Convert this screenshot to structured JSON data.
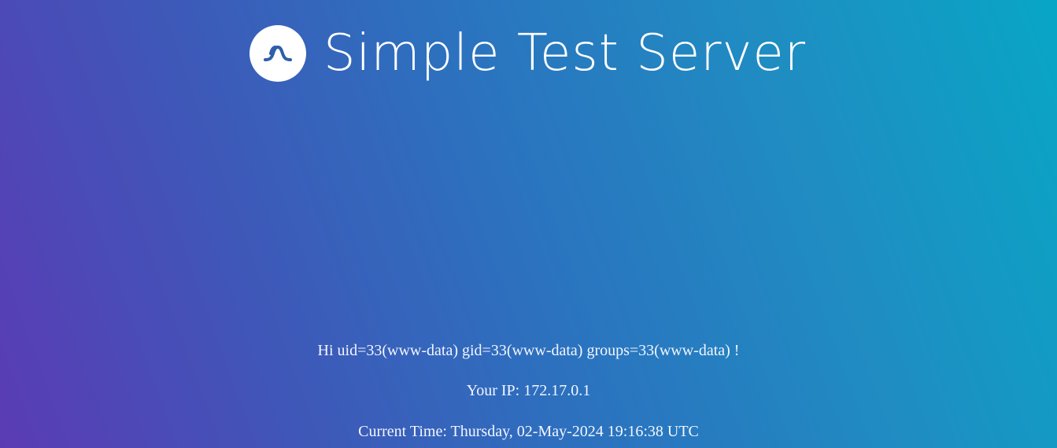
{
  "header": {
    "title": "Simple Test Server",
    "logo_icon": "wave-logo-icon"
  },
  "info": {
    "greeting": "Hi uid=33(www-data) gid=33(www-data) groups=33(www-data) !",
    "ip": "Your IP: 172.17.0.1",
    "time": "Current Time: Thursday, 02-May-2024 19:16:38 UTC"
  },
  "colors": {
    "gradient_start": "#5b3bb5",
    "gradient_end": "#08a6c6",
    "logo_stroke": "#2f5fa8",
    "text": "#ffffff"
  }
}
